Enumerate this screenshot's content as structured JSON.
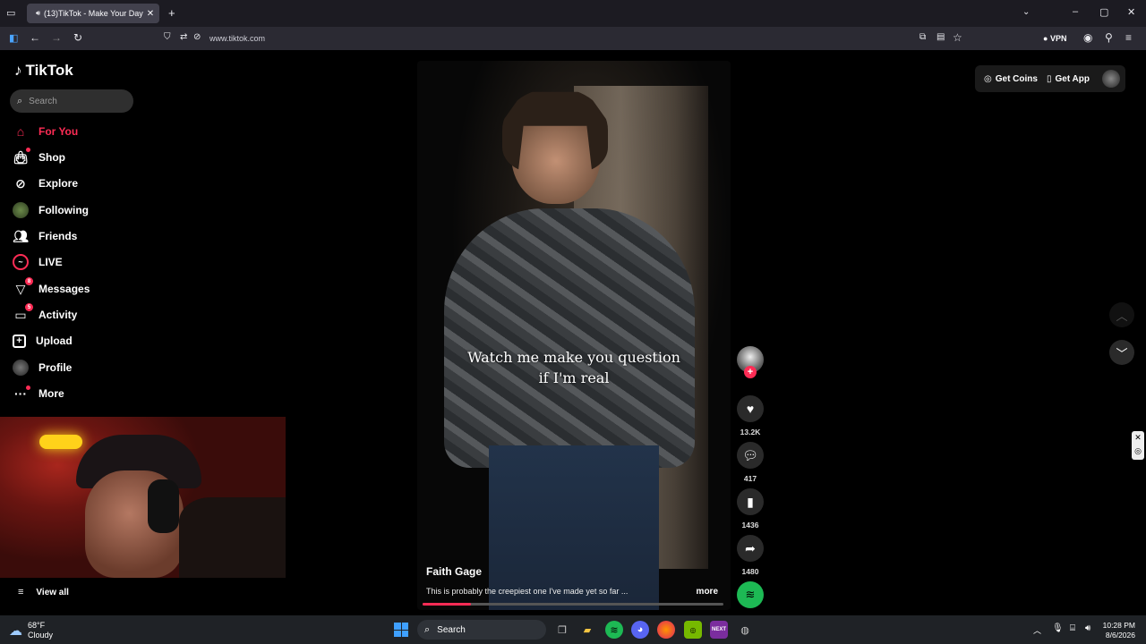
{
  "browser": {
    "tab_title": "(13)TikTok - Make Your Day",
    "url": "www.tiktok.com",
    "vpn_label": "VPN"
  },
  "tiktok": {
    "logo_text": "TikTok",
    "search_placeholder": "Search",
    "nav": [
      {
        "label": "For You",
        "icon": "home-icon",
        "active": true
      },
      {
        "label": "Shop",
        "icon": "shopping-bag-icon"
      },
      {
        "label": "Explore",
        "icon": "compass-icon"
      },
      {
        "label": "Following",
        "icon": "avatar-icon"
      },
      {
        "label": "Friends",
        "icon": "friends-icon"
      },
      {
        "label": "LIVE",
        "icon": "live-icon"
      },
      {
        "label": "Messages",
        "icon": "messages-icon",
        "badge": "8"
      },
      {
        "label": "Activity",
        "icon": "activity-icon",
        "badge": "5"
      },
      {
        "label": "Upload",
        "icon": "upload-icon"
      },
      {
        "label": "Profile",
        "icon": "profile-icon"
      },
      {
        "label": "More",
        "icon": "more-icon"
      }
    ],
    "view_all": "View all",
    "get_coins": "Get Coins",
    "get_app": "Get App",
    "video": {
      "caption_line1": "Watch me make you question",
      "caption_line2": "if I'm real",
      "author": "Faith Gage",
      "description": "This is probably the creepiest one I've made yet so far ...",
      "more": "more",
      "progress": 0.16
    },
    "actions": {
      "likes": "13.2K",
      "comments": "417",
      "bookmarks": "1436",
      "shares": "1480"
    },
    "accent_color": "#fe2c55"
  },
  "taskbar": {
    "temperature": "68°F",
    "weather": "Cloudy",
    "search_label": "Search",
    "time": "10:28 PM",
    "date": "8/6/2026"
  }
}
